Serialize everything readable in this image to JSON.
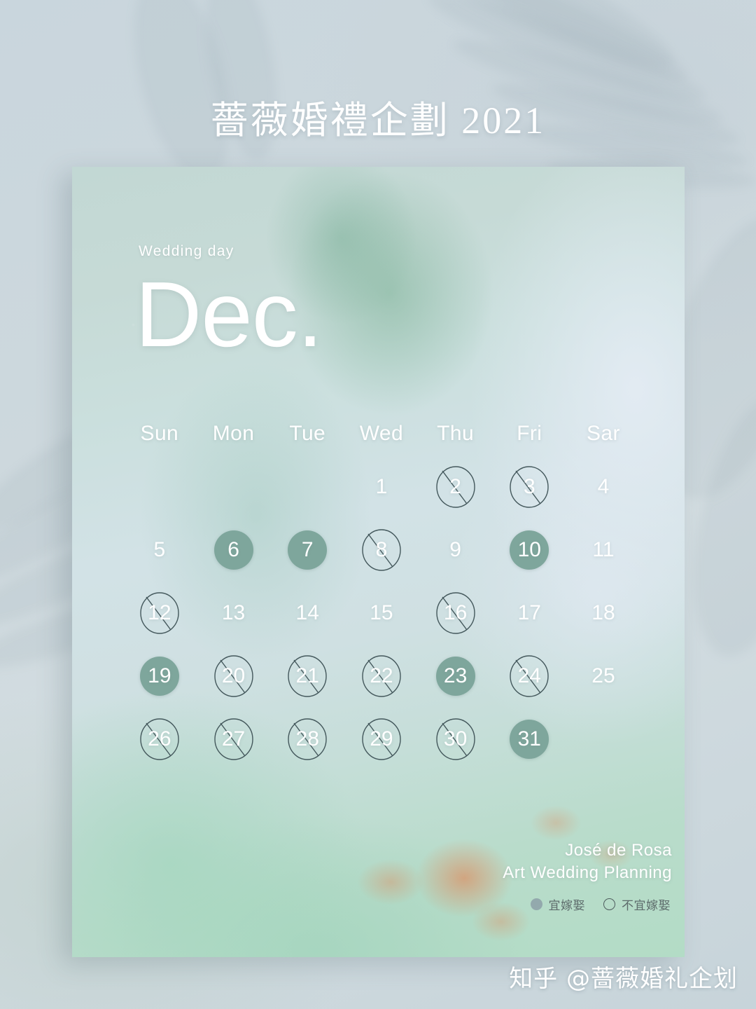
{
  "page": {
    "title": "薔薇婚禮企劃 2021",
    "watermark": "知乎 @蔷薇婚礼企划",
    "background_color": "#cdd8dd"
  },
  "poster": {
    "eyebrow": "Wedding day",
    "month": "Dec.",
    "accent_color": "#7ea69c",
    "weekdays": [
      "Sun",
      "Mon",
      "Tue",
      "Wed",
      "Thu",
      "Fri",
      "Sar"
    ],
    "weeks": [
      [
        {
          "label": "",
          "state": "empty"
        },
        {
          "label": "",
          "state": "empty"
        },
        {
          "label": "",
          "state": "empty"
        },
        {
          "label": "1",
          "state": "plain"
        },
        {
          "label": "2",
          "state": "bad"
        },
        {
          "label": "3",
          "state": "bad"
        },
        {
          "label": "4",
          "state": "plain"
        }
      ],
      [
        {
          "label": "5",
          "state": "plain"
        },
        {
          "label": "6",
          "state": "good"
        },
        {
          "label": "7",
          "state": "good"
        },
        {
          "label": "8",
          "state": "bad"
        },
        {
          "label": "9",
          "state": "plain"
        },
        {
          "label": "10",
          "state": "good"
        },
        {
          "label": "11",
          "state": "plain"
        }
      ],
      [
        {
          "label": "12",
          "state": "bad"
        },
        {
          "label": "13",
          "state": "plain"
        },
        {
          "label": "14",
          "state": "plain"
        },
        {
          "label": "15",
          "state": "plain"
        },
        {
          "label": "16",
          "state": "bad"
        },
        {
          "label": "17",
          "state": "plain"
        },
        {
          "label": "18",
          "state": "plain"
        }
      ],
      [
        {
          "label": "19",
          "state": "good"
        },
        {
          "label": "20",
          "state": "bad"
        },
        {
          "label": "21",
          "state": "bad"
        },
        {
          "label": "22",
          "state": "bad"
        },
        {
          "label": "23",
          "state": "good"
        },
        {
          "label": "24",
          "state": "bad"
        },
        {
          "label": "25",
          "state": "plain"
        }
      ],
      [
        {
          "label": "26",
          "state": "bad"
        },
        {
          "label": "27",
          "state": "bad"
        },
        {
          "label": "28",
          "state": "bad"
        },
        {
          "label": "29",
          "state": "bad"
        },
        {
          "label": "30",
          "state": "bad"
        },
        {
          "label": "31",
          "state": "good"
        },
        {
          "label": "",
          "state": "empty"
        }
      ]
    ],
    "signature": {
      "line1": "José de Rosa",
      "line2": "Art Wedding Planning"
    },
    "legend": {
      "good_label": "宜嫁娶",
      "bad_label": "不宜嫁娶",
      "good_swatch_color": "#93a9ad",
      "bad_swatch_color": "#4e5c5e"
    }
  }
}
